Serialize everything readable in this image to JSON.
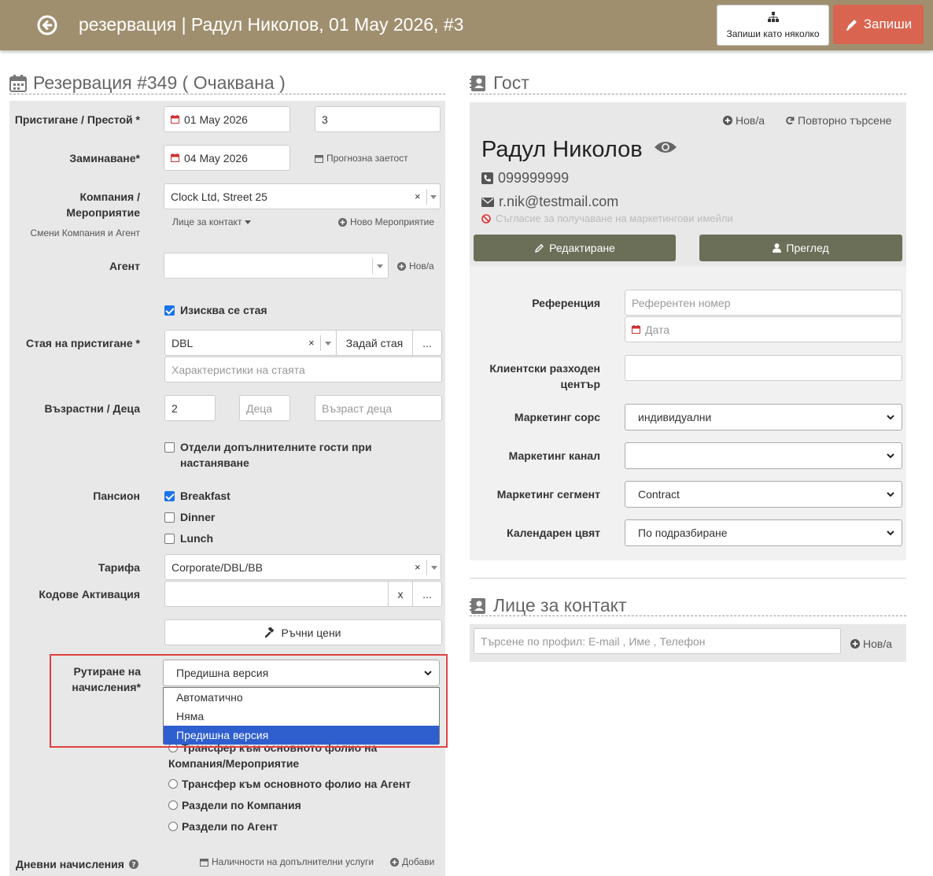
{
  "header": {
    "title": "резервация | Радул Николов, 01 May 2026, #3",
    "save_many_label": "Запиши като няколко",
    "save_label": "Запиши"
  },
  "reservation": {
    "heading": "Резервация #349 ( Очаквана )",
    "arrival_label": "Пристигане / Престой *",
    "arrival_date": "01 May 2026",
    "nights": "3",
    "departure_label": "Заминаване*",
    "departure_date": "04 May 2026",
    "forecast_link": "Прогнозна заетост",
    "company_label": "Компания / Мероприятие",
    "company_value": "Clock Ltd, Street 25",
    "change_company_link": "Смени Компания и Агент",
    "contact_person_link": "Лице за контакт",
    "new_event_link": "Ново Мероприятие",
    "agent_label": "Агент",
    "agent_value": "",
    "agent_new_link": "Нов/а",
    "room_required_label": "Изисква се стая",
    "room_label": "Стая на пристигане *",
    "room_value": "DBL",
    "assign_room_label": "Задай стая",
    "more_label": "...",
    "room_features_placeholder": "Характеристики на стаята",
    "adults_label": "Възрастни / Деца",
    "adults_value": "2",
    "children_placeholder": "Деца",
    "children_age_placeholder": "Възраст деца",
    "separate_guests_label": "Отдели допълнителните гости при настаняване",
    "board_label": "Пансион",
    "board_options": [
      "Breakfast",
      "Dinner",
      "Lunch"
    ],
    "tariff_label": "Тарифа",
    "tariff_value": "Corporate/DBL/BB",
    "activation_label": "Кодове Активация",
    "activation_clear": "x",
    "manual_prices_label": "Ръчни цени",
    "routing_label": "Рутиране на начисления*",
    "routing_selected": "Предишна версия",
    "routing_options": [
      "Автоматично",
      "Няма",
      "Предишна версия"
    ],
    "routing_radios": [
      "Трансфер към основното фолио на Компания/Мероприятие",
      "Трансфер към основното фолио на Агент",
      "Раздели по Компания",
      "Раздели по Агент"
    ],
    "daily_charges_label": "Дневни начисления",
    "extras_availability_link": "Наличности на допълнителни услуги",
    "add_link": "Добави"
  },
  "guest": {
    "heading": "Гост",
    "new_link": "Нов/а",
    "search_again_link": "Повторно търсене",
    "name": "Радул Николов",
    "phone": "099999999",
    "email": "r.nik@testmail.com",
    "consent": "Съгласие за получаване на маркетингови имейли",
    "edit_label": "Редактиране",
    "view_label": "Преглед",
    "reference_label": "Референция",
    "reference_placeholder": "Референтен номер",
    "date_placeholder": "Дата",
    "cost_center_label": "Клиентски разходен център",
    "marketing_source_label": "Маркетинг сорс",
    "marketing_source_value": "индивидуални",
    "marketing_channel_label": "Маркетинг канал",
    "marketing_channel_value": "",
    "marketing_segment_label": "Маркетинг сегмент",
    "marketing_segment_value": "Contract",
    "calendar_color_label": "Календарен цвят",
    "calendar_color_value": "По подразбиране"
  },
  "contact": {
    "heading": "Лице за контакт",
    "search_placeholder": "Търсене по профил: E-mail , Име , Телефон",
    "new_link": "Нов/а"
  }
}
